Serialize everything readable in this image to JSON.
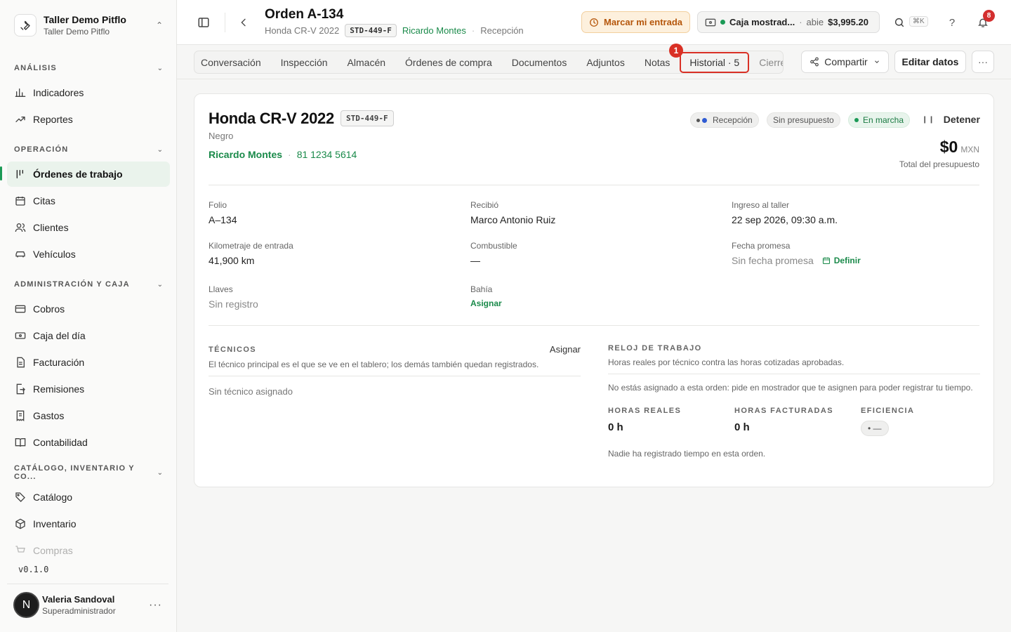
{
  "workspace": {
    "name": "Taller Demo Pitflo",
    "subtitle": "Taller Demo Pitflo"
  },
  "sidebar": {
    "sections": [
      {
        "title": "ANÁLISIS",
        "items": [
          "Indicadores",
          "Reportes"
        ]
      },
      {
        "title": "OPERACIÓN",
        "items": [
          "Órdenes de trabajo",
          "Citas",
          "Clientes",
          "Vehículos"
        ]
      },
      {
        "title": "ADMINISTRACIÓN Y CAJA",
        "items": [
          "Cobros",
          "Caja del día",
          "Facturación",
          "Remisiones",
          "Gastos",
          "Contabilidad"
        ]
      },
      {
        "title": "CATÁLOGO, INVENTARIO Y CO...",
        "items": [
          "Catálogo",
          "Inventario",
          "Compras"
        ]
      }
    ],
    "active_item": "Órdenes de trabajo",
    "version": "v0.1.0",
    "user": {
      "initial": "N",
      "name": "Valeria Sandoval",
      "role": "Superadministrador"
    }
  },
  "header": {
    "title": "Orden A-134",
    "vehicle": "Honda CR-V 2022",
    "plate": "STD-449-F",
    "client": "Ricardo Montes",
    "stage": "Recepción",
    "checkin_label": "Marcar mi entrada",
    "cash": {
      "label": "Caja mostrad...",
      "state": "abie",
      "amount": "$3,995.20"
    },
    "search_shortcut": "⌘K",
    "help": "?",
    "notifications_count": "8"
  },
  "tabs": {
    "items": [
      "Conversación",
      "Inspección",
      "Almacén",
      "Órdenes de compra",
      "Documentos",
      "Adjuntos",
      "Notas",
      "Historial · 5",
      "Cierre"
    ],
    "highlighted": "Historial · 5",
    "marker": "1",
    "share_label": "Compartir",
    "edit_label": "Editar datos",
    "more_label": "···"
  },
  "vehicle_card": {
    "title": "Honda CR-V 2022",
    "plate": "STD-449-F",
    "color": "Negro",
    "client": "Ricardo Montes",
    "phone": "81 1234 5614",
    "chips": {
      "stage": "Recepción",
      "budget": "Sin presupuesto",
      "status": "En marcha"
    },
    "stop_label": "Detener",
    "total_amount": "$0",
    "currency": "MXN",
    "total_label": "Total del presupuesto"
  },
  "details": {
    "folio": {
      "label": "Folio",
      "value": "A–134"
    },
    "received_by": {
      "label": "Recibió",
      "value": "Marco Antonio Ruiz"
    },
    "checkin": {
      "label": "Ingreso al taller",
      "value": "22 sep 2026, 09:30 a.m."
    },
    "mileage": {
      "label": "Kilometraje de entrada",
      "value": "41,900 km"
    },
    "fuel": {
      "label": "Combustible",
      "value": "—"
    },
    "promise": {
      "label": "Fecha promesa",
      "value": "Sin fecha promesa",
      "action": "Definir"
    },
    "keys": {
      "label": "Llaves",
      "value": "Sin registro"
    },
    "bay": {
      "label": "Bahía",
      "action": "Asignar"
    }
  },
  "technicians": {
    "title": "TÉCNICOS",
    "action": "Asignar",
    "description": "El técnico principal es el que se ve en el tablero; los demás también quedan registrados.",
    "empty": "Sin técnico asignado"
  },
  "work_clock": {
    "title": "RELOJ DE TRABAJO",
    "description": "Horas reales por técnico contra las horas cotizadas aprobadas.",
    "notice": "No estás asignado a esta orden: pide en mostrador que te asignen para poder registrar tu tiempo.",
    "real_hours": {
      "label": "HORAS REALES",
      "value": "0 h"
    },
    "billed_hours": {
      "label": "HORAS FACTURADAS",
      "value": "0 h"
    },
    "efficiency": {
      "label": "EFICIENCIA",
      "value": "• —"
    },
    "footer": "Nadie ha registrado tiempo en esta orden."
  },
  "colors": {
    "accent": "#1b9a56",
    "highlight": "#d93025",
    "warning_bg": "#fdf0dd",
    "warning_text": "#b5560b"
  }
}
